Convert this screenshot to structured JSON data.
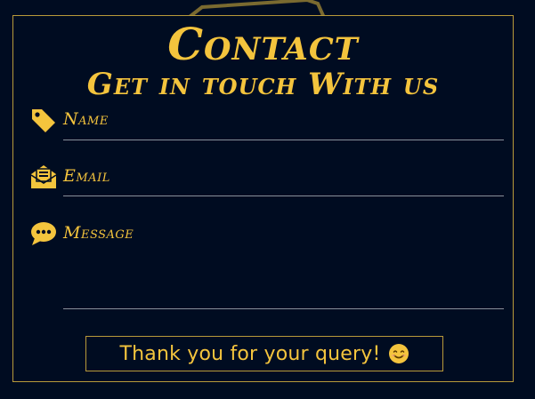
{
  "header": {
    "title": "Contact",
    "subtitle": "Get in touch With us"
  },
  "form": {
    "fields": [
      {
        "label": "Name",
        "icon": "tag-icon",
        "value": ""
      },
      {
        "label": "Email",
        "icon": "envelope-open-icon",
        "value": ""
      },
      {
        "label": "Message",
        "icon": "speech-bubble-icon",
        "value": ""
      }
    ],
    "submit_label": "Thank you for your query!",
    "submit_icon": "smiley-icon"
  },
  "colors": {
    "background": "#000c21",
    "accent": "#f4c43d",
    "border": "#b89a3a",
    "divider": "#8a8f9a"
  }
}
